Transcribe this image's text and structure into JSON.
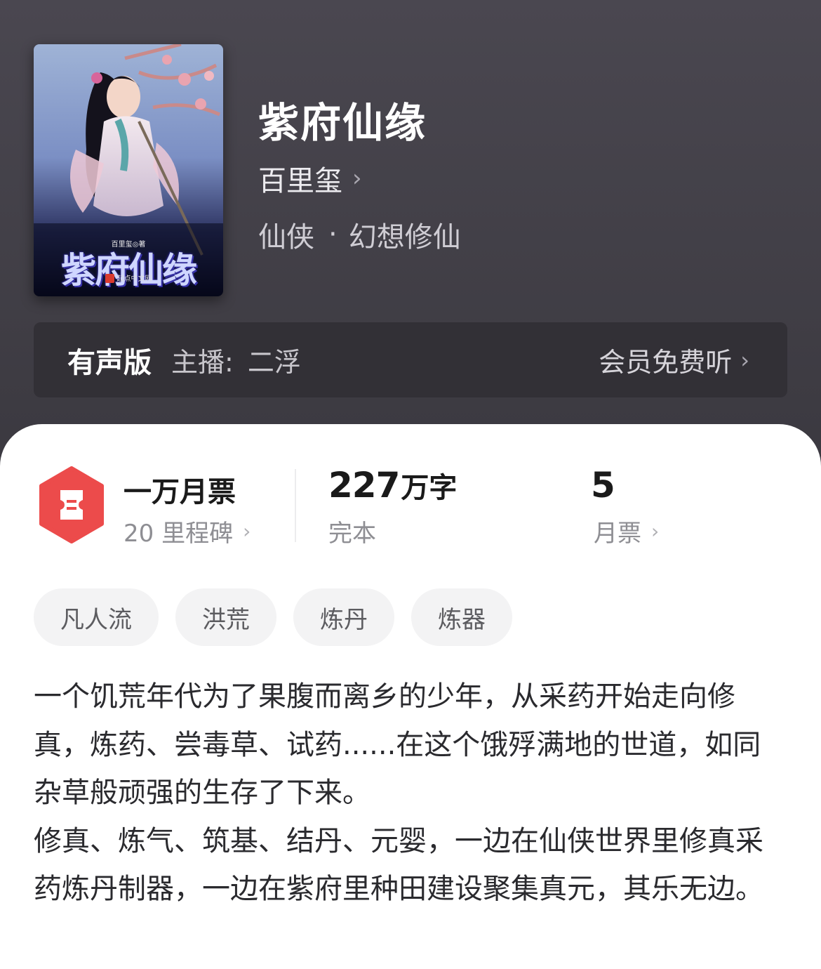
{
  "book": {
    "title": "紫府仙缘",
    "author": "百里玺",
    "category": "仙侠",
    "subcategory": "幻想修仙",
    "cover": {
      "title": "紫府仙缘",
      "author_line": "百里玺◎著",
      "publisher": "起点中文网"
    }
  },
  "audio": {
    "label": "有声版",
    "narrator_label": "主播:",
    "narrator": "二浮",
    "action": "会员免费听"
  },
  "stats": {
    "monthly_ticket_title": "一万月票",
    "milestones": "20 里程碑",
    "word_count": "227",
    "word_unit": "万字",
    "status": "完本",
    "tickets": "5",
    "tickets_label": "月票"
  },
  "tags": [
    "凡人流",
    "洪荒",
    "炼丹",
    "炼器"
  ],
  "synopsis": [
    "一个饥荒年代为了果腹而离乡的少年，从采药开始走向修真，炼药、尝毒草、试药......在这个饿殍满地的世道，如同杂草般顽强的生存了下来。",
    "修真、炼气、筑基、结丹、元婴，一边在仙侠世界里修真采药炼丹制器，一边在紫府里种田建设聚集真元，其乐无边。"
  ],
  "colors": {
    "header_bg": "#45434b",
    "ticket_red": "#ec4b4b",
    "chevron": "#a9a7b0"
  }
}
